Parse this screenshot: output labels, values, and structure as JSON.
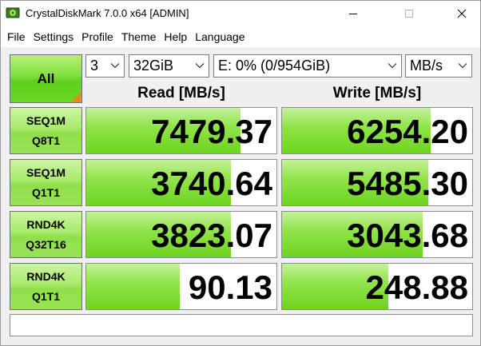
{
  "window": {
    "title": "CrystalDiskMark 7.0.0 x64 [ADMIN]"
  },
  "menu": [
    "File",
    "Settings",
    "Profile",
    "Theme",
    "Help",
    "Language"
  ],
  "controls": {
    "all_label": "All",
    "count": "3",
    "size": "32GiB",
    "drive": "E: 0% (0/954GiB)",
    "unit": "MB/s"
  },
  "headers": {
    "read": "Read [MB/s]",
    "write": "Write [MB/s]"
  },
  "tests": [
    {
      "line1": "SEQ1M",
      "line2": "Q8T1",
      "read": "7479.37",
      "write": "6254.20",
      "read_fill": 0.81,
      "write_fill": 0.78
    },
    {
      "line1": "SEQ1M",
      "line2": "Q1T1",
      "read": "3740.64",
      "write": "5485.30",
      "read_fill": 0.76,
      "write_fill": 0.77
    },
    {
      "line1": "RND4K",
      "line2": "Q32T16",
      "read": "3823.07",
      "write": "3043.68",
      "read_fill": 0.76,
      "write_fill": 0.74
    },
    {
      "line1": "RND4K",
      "line2": "Q1T1",
      "read": "90.13",
      "write": "248.88",
      "read_fill": 0.49,
      "write_fill": 0.56
    }
  ],
  "comment": "",
  "colors": {
    "accent_green": "#6ed41e",
    "corner_orange": "#f0821e"
  },
  "icons": {
    "app": "crystaldiskmark-icon",
    "minimize": "minimize-icon",
    "maximize": "maximize-icon",
    "close": "close-icon",
    "dropdown": "chevron-down-icon"
  }
}
